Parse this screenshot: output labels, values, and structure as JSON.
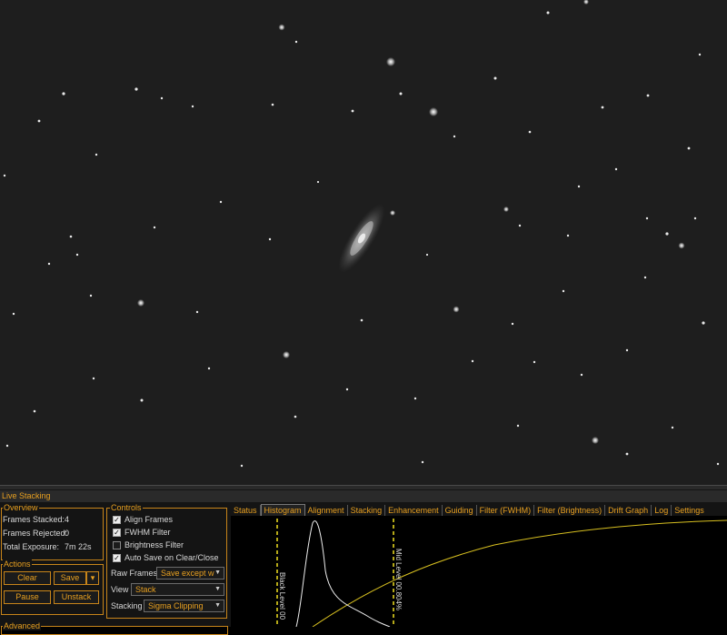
{
  "title": "Live Stacking",
  "overview": {
    "group_label": "Overview",
    "frames_stacked_label": "Frames Stacked:",
    "frames_stacked_value": "4",
    "frames_rejected_label": "Frames Rejected:",
    "frames_rejected_value": "0",
    "total_exposure_label": "Total Exposure:",
    "total_exposure_value": "7m 22s"
  },
  "actions": {
    "group_label": "Actions",
    "clear": "Clear",
    "save": "Save",
    "save_dropdown": "▾",
    "pause": "Pause",
    "unstack": "Unstack"
  },
  "advanced_label": "Advanced",
  "controls": {
    "group_label": "Controls",
    "align_frames": "Align Frames",
    "fwhm_filter": "FWHM Filter",
    "brightness_filter": "Brightness Filter",
    "auto_save": "Auto Save on Clear/Close",
    "raw_frames_label": "Raw Frames",
    "raw_frames_value": "Save except w",
    "view_label": "View",
    "view_value": "Stack",
    "stacking_label": "Stacking",
    "stacking_value": "Sigma Clipping",
    "checked_mark": "✓",
    "dropdown_arrow": "▼"
  },
  "tabs": [
    "Status",
    "Histogram",
    "Alignment",
    "Stacking",
    "Enhancement",
    "Guiding",
    "Filter (FWHM)",
    "Filter (Brightness)",
    "Drift Graph",
    "Log",
    "Settings"
  ],
  "histogram": {
    "black_level_label": "Black Level 00",
    "mid_level_label": "Mid Level 00.804%"
  },
  "colors": {
    "accent": "#e8a020",
    "curve": "#d8c020"
  }
}
